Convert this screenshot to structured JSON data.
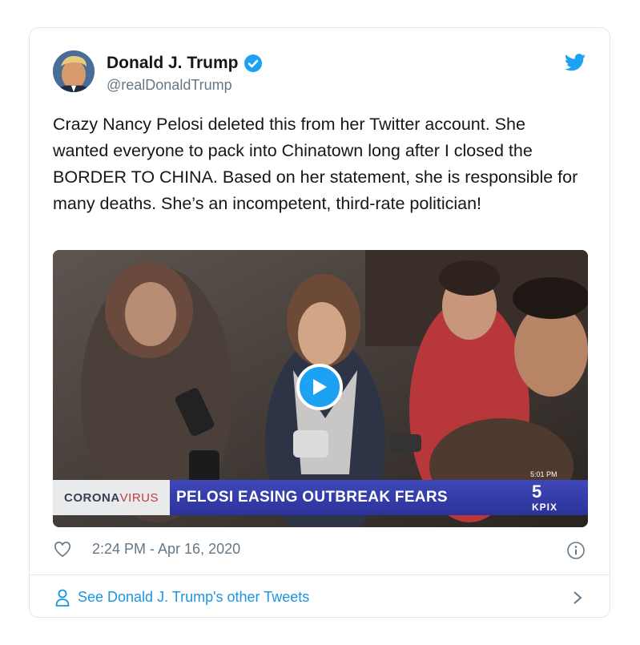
{
  "tweet": {
    "author_name": "Donald J. Trump",
    "handle": "@realDonaldTrump",
    "text": "Crazy Nancy Pelosi deleted this from her Twitter account. She wanted everyone to pack into Chinatown long after I closed the BORDER TO CHINA. Based on her statement, she is responsible for many deaths. She’s an incompetent, third-rate politician!",
    "timestamp": "2:24 PM - Apr 16, 2020",
    "footer_link": "See Donald J. Trump's other Tweets"
  },
  "video": {
    "banner_prefix": "CORONA",
    "banner_suffix": "VIRUS",
    "headline": "PELOSI EASING OUTBREAK FEARS",
    "clock": "5:01 PM",
    "channel": "5",
    "station": "KPIX"
  },
  "icons": {
    "verified": "verified-badge-icon",
    "brand": "twitter-bird-icon",
    "like": "heart-icon",
    "info": "info-icon",
    "profile": "person-icon",
    "chevron": "chevron-right-icon",
    "play": "play-icon"
  },
  "colors": {
    "brand_blue": "#1da1f2",
    "link_blue": "#1b95e0",
    "secondary_text": "#657786",
    "border": "#e1e8ed",
    "banner_blue": "#2b329a"
  }
}
